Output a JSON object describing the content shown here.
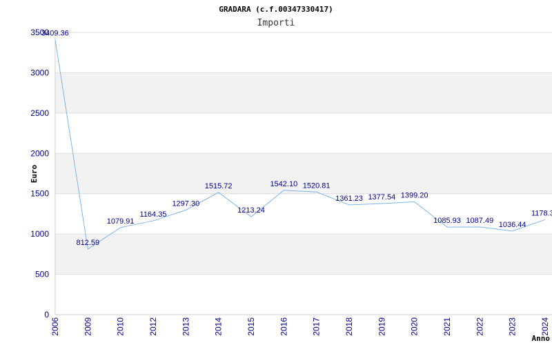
{
  "chart_data": {
    "type": "line",
    "title": "GRADARA (c.f.00347330417)",
    "subtitle": "Importi",
    "xlabel": "Anno",
    "ylabel": "Euro",
    "categories": [
      "2006",
      "2009",
      "2010",
      "2012",
      "2013",
      "2014",
      "2015",
      "2016",
      "2017",
      "2018",
      "2019",
      "2020",
      "2021",
      "2022",
      "2023",
      "2024"
    ],
    "series": [
      {
        "values": [
          3409.36,
          812.59,
          1079.91,
          1164.35,
          1297.3,
          1515.72,
          1213.24,
          1542.1,
          1520.81,
          1361.23,
          1377.54,
          1399.2,
          1085.93,
          1087.49,
          1036.44,
          1178.3
        ],
        "labels": [
          "3409.36",
          "812.59",
          "1079.91",
          "1164.35",
          "1297.30",
          "1515.72",
          "1213.24",
          "1542.10",
          "1520.81",
          "1361.23",
          "1377.54",
          "1399.20",
          "1085.93",
          "1087.49",
          "1036.44",
          "1178.3"
        ]
      }
    ],
    "ylim": [
      0,
      3500
    ],
    "yticks": [
      0,
      500,
      1000,
      1500,
      2000,
      2500,
      3000,
      3500
    ],
    "grid": true,
    "colors": {
      "line": "#7db4e6",
      "band": "#f2f2f2",
      "tick_text": "#00008b",
      "grid": "#dddddd"
    }
  }
}
